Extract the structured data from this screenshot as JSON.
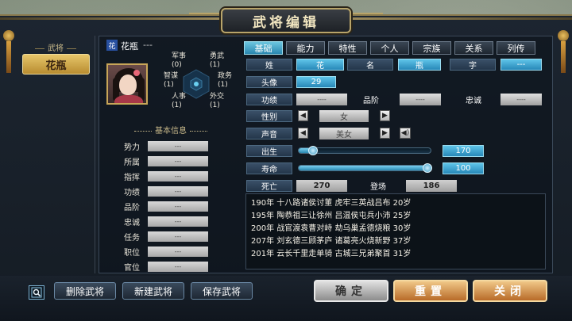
{
  "dialog": {
    "title": "武将编辑"
  },
  "left": {
    "section_label": "武将",
    "selected_name": "花瓶"
  },
  "officer": {
    "flag": "花",
    "name": "花瓶",
    "title": "---",
    "stats": {
      "military": "军事\n(0)",
      "valor": "勇武\n(1)",
      "intellect": "智谋\n(1)",
      "politics": "政务\n(1)",
      "personnel": "人事\n(1)",
      "diplomacy": "外交\n(1)"
    }
  },
  "basic_info": {
    "title": "基本信息",
    "rows": [
      {
        "label": "势力",
        "value": "---"
      },
      {
        "label": "所属",
        "value": "---"
      },
      {
        "label": "指挥",
        "value": "---"
      },
      {
        "label": "功绩",
        "value": "---"
      },
      {
        "label": "品阶",
        "value": "---"
      },
      {
        "label": "忠诚",
        "value": "---"
      },
      {
        "label": "任务",
        "value": "---"
      },
      {
        "label": "职位",
        "value": "---"
      },
      {
        "label": "官位",
        "value": "---"
      }
    ]
  },
  "tabs": [
    "基础",
    "能力",
    "特性",
    "个人",
    "宗族",
    "关系",
    "列传"
  ],
  "fields": {
    "surname_label": "姓",
    "surname_value": "花",
    "given_label": "名",
    "given_value": "瓶",
    "style_label": "字",
    "style_value": "---",
    "portrait_label": "头像",
    "portrait_value": "29",
    "merit_label": "功绩",
    "merit_value": "----",
    "rank_label": "品阶",
    "rank_value": "----",
    "loyalty_label": "忠诚",
    "loyalty_value": "----",
    "gender_label": "性别",
    "gender_value": "女",
    "voice_label": "声音",
    "voice_value": "美女",
    "birth_label": "出生",
    "birth_value": "170",
    "birth_slider": 0.08,
    "lifespan_label": "寿命",
    "lifespan_value": "100",
    "lifespan_slider": 1.0,
    "death_label": "死亡",
    "death_value": "270",
    "debut_label": "登场",
    "debut_value": "186"
  },
  "history": [
    "190年 十八路诸侯讨董 虎牢三英战吕布 20岁",
    "195年 陶恭祖三让徐州 吕温侯屯兵小沛 25岁",
    "200年 战官渡袁曹对峙 劫乌巢孟德烧粮 30岁",
    "207年 刘玄德三顾茅庐 诸葛亮火烧新野 37岁",
    "201年 云长千里走单骑 古城三兄弟聚首 31岁"
  ],
  "buttons": {
    "delete": "删除武将",
    "create": "新建武将",
    "save": "保存武将",
    "confirm": "确定",
    "reset": "重置",
    "close": "关闭"
  }
}
